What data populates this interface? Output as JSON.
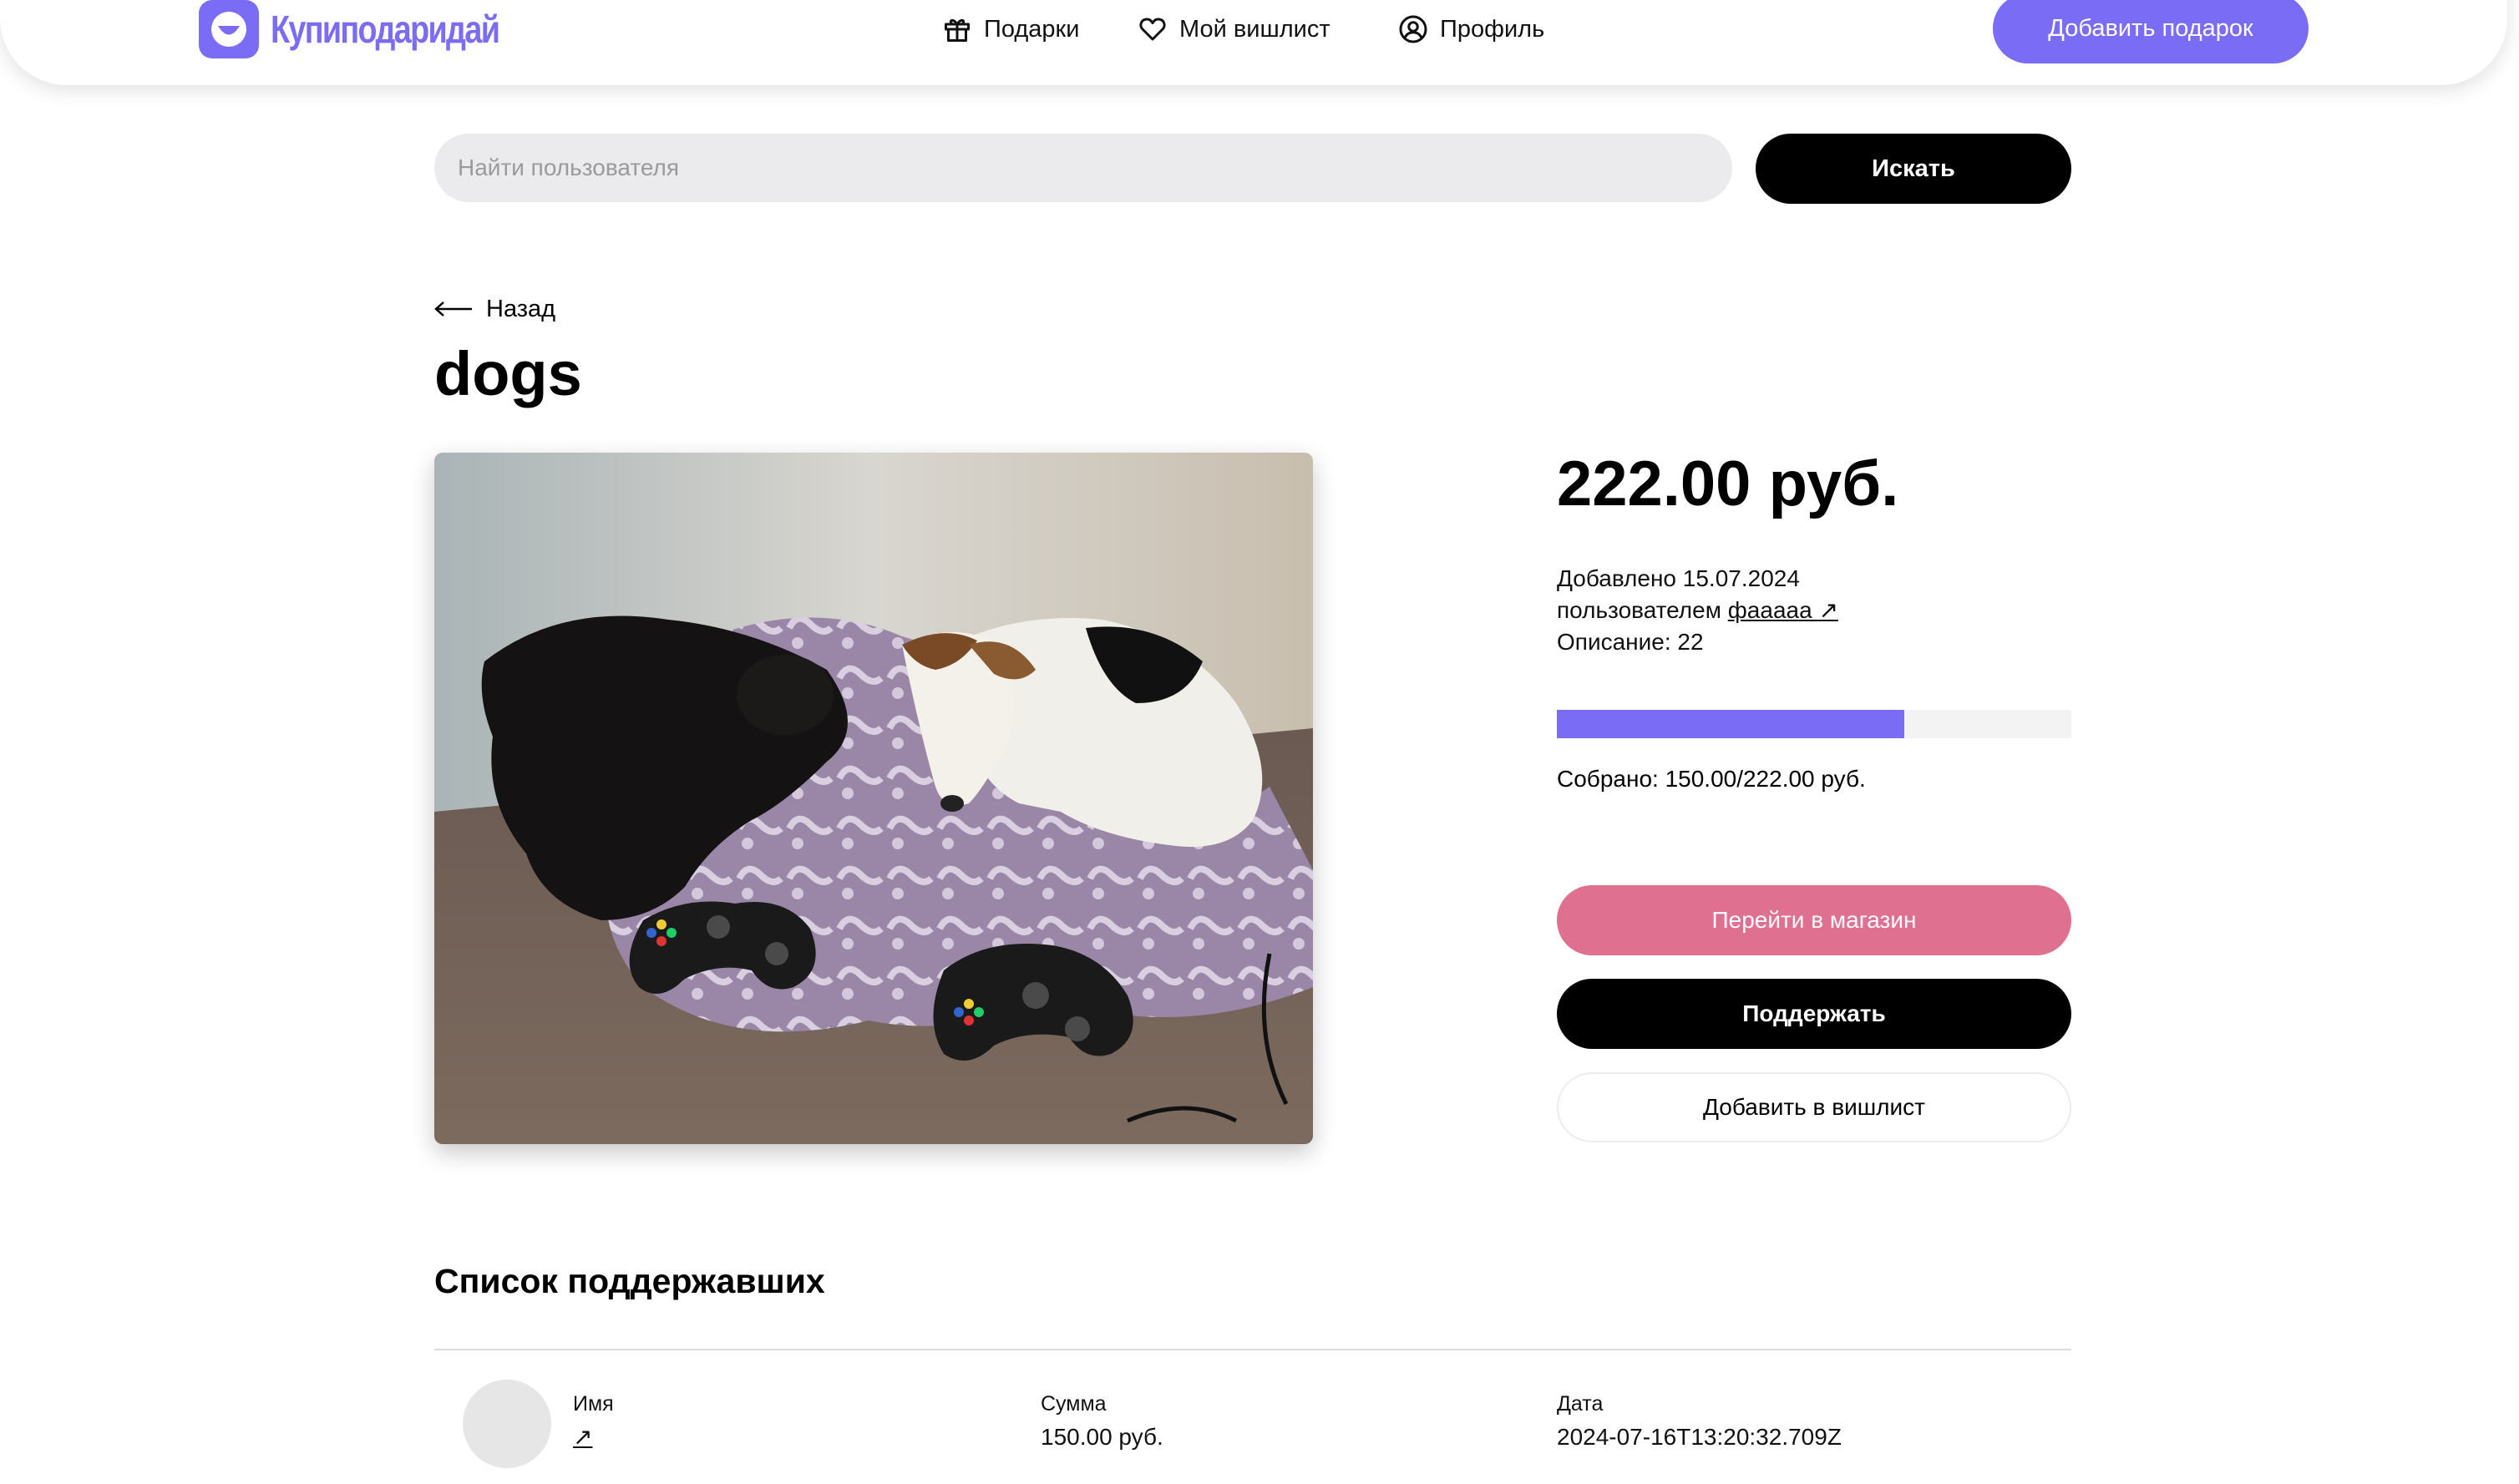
{
  "header": {
    "brand": "Купиподаридай",
    "nav": [
      {
        "label": "Подарки",
        "icon": "gift-icon"
      },
      {
        "label": "Мой вишлист",
        "icon": "heart-icon"
      },
      {
        "label": "Профиль",
        "icon": "user-circle-icon"
      }
    ],
    "add_gift": "Добавить подарок"
  },
  "search": {
    "placeholder": "Найти пользователя",
    "button": "Искать"
  },
  "back": "Назад",
  "gift": {
    "title": "dogs",
    "price": "222.00 руб.",
    "added": "Добавлено 15.07.2024",
    "by_prefix": "пользователем",
    "owner": "фааааа ↗",
    "description": "Описание: 22",
    "raised_text": "Собрано: 150.00/222.00 руб.",
    "raised_fraction": 0.676,
    "image_alt": "two dogs on a blanket with game controllers"
  },
  "actions": {
    "shop": "Перейти в магазин",
    "support": "Поддержать",
    "wishlist": "Добавить в вишлист"
  },
  "supporters": {
    "title": "Список поддержавших",
    "columns": {
      "name": "Имя",
      "amount": "Сумма",
      "date": "Дата"
    },
    "rows": [
      {
        "name_link": "↗",
        "amount": "150.00 руб.",
        "date": "2024-07-16T13:20:32.709Z"
      }
    ]
  },
  "colors": {
    "accent": "#7b6cf6",
    "shop_button": "#e0708f",
    "primary_button": "#000000"
  }
}
